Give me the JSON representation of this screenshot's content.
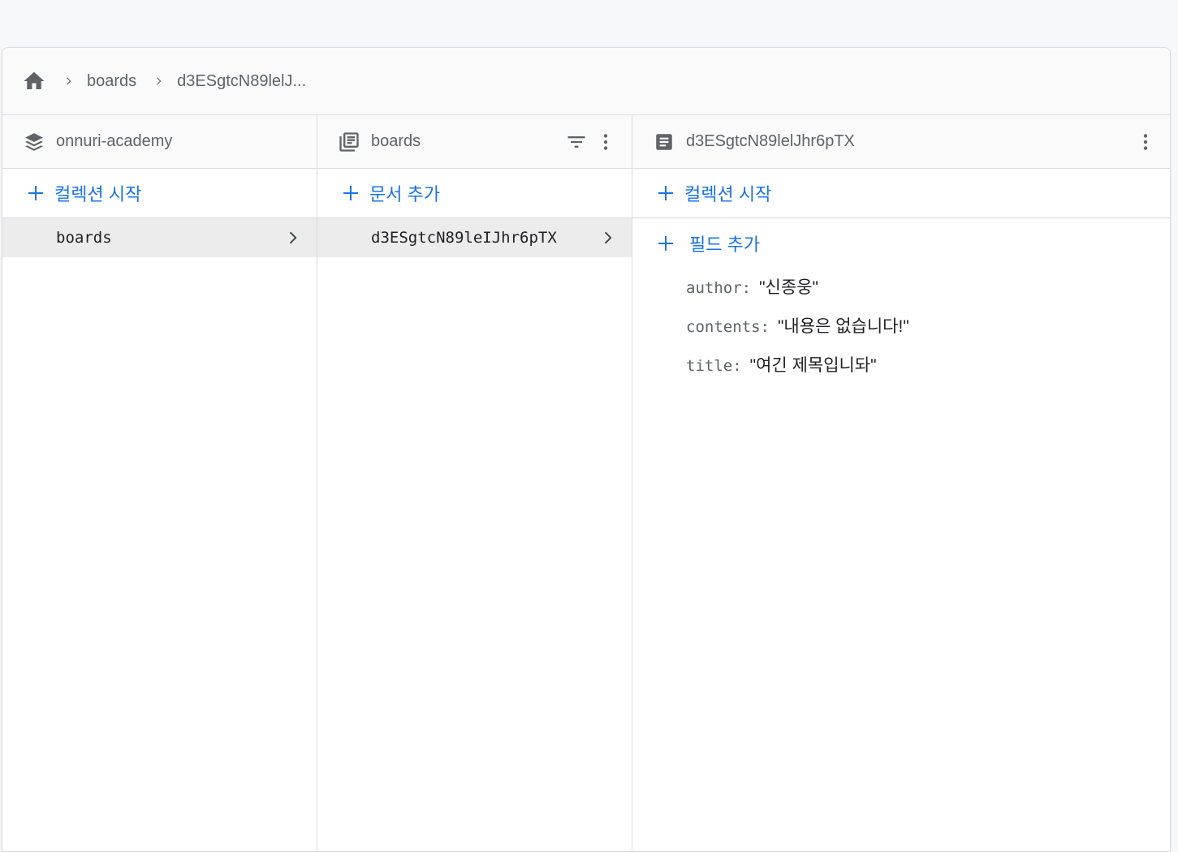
{
  "breadcrumb": {
    "home_icon": "home-icon",
    "items": [
      "boards",
      "d3ESgtcN89lelJ..."
    ]
  },
  "colors": {
    "accent": "#1a73e8",
    "selected_row": "#ececec",
    "border": "#dadce0"
  },
  "col1": {
    "icon": "firestore-layers-icon",
    "title": "onnuri-academy",
    "action_label": "컬렉션 시작",
    "items": [
      {
        "label": "boards"
      }
    ]
  },
  "col2": {
    "icon": "collection-icon",
    "title": "boards",
    "filter_icon": "filter-list-icon",
    "menu_icon": "more-vert-icon",
    "action_label": "문서 추가",
    "items": [
      {
        "label": "d3ESgtcN89leIJhr6pTX"
      }
    ]
  },
  "col3": {
    "icon": "document-icon",
    "title": "d3ESgtcN89lelJhr6pTX",
    "menu_icon": "more-vert-icon",
    "start_collection_label": "컬렉션 시작",
    "add_field_label": "필드 추가",
    "fields": [
      {
        "key": "author",
        "value": "\"신종웅\""
      },
      {
        "key": "contents",
        "value": "\"내용은 없습니다!\""
      },
      {
        "key": "title",
        "value": "\"여긴 제목입니돠\""
      }
    ]
  }
}
